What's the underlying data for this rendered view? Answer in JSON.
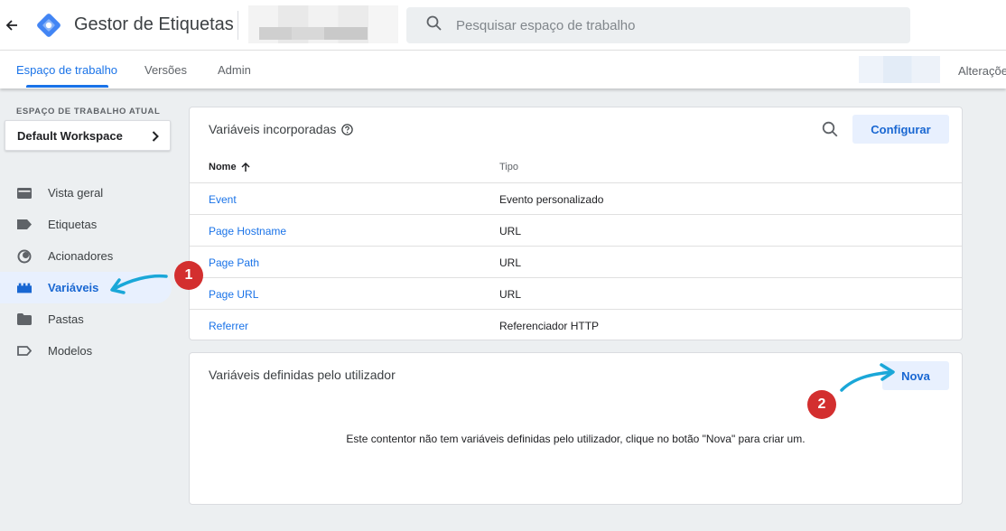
{
  "header": {
    "title": "Gestor de Etiquetas",
    "search_placeholder": "Pesquisar espaço de trabalho",
    "icons": [
      "back-arrow-icon",
      "tag-manager-logo-icon",
      "search-icon"
    ]
  },
  "tabs": [
    {
      "label": "Espaço de trabalho",
      "active": true
    },
    {
      "label": "Versões"
    },
    {
      "label": "Admin"
    }
  ],
  "toolbar_right": {
    "label": "Alterações"
  },
  "sidebar": {
    "workspace_label": "ESPAÇO DE TRABALHO ATUAL",
    "workspace_name": "Default Workspace",
    "items": [
      {
        "label": "Vista geral",
        "icon": "folder-overview-icon"
      },
      {
        "label": "Etiquetas",
        "icon": "tag-icon"
      },
      {
        "label": "Acionadores",
        "icon": "trigger-icon"
      },
      {
        "label": "Variáveis",
        "icon": "variables-icon",
        "active": true
      },
      {
        "label": "Pastas",
        "icon": "folder-icon"
      },
      {
        "label": "Modelos",
        "icon": "template-icon"
      }
    ]
  },
  "builtin": {
    "title": "Variáveis incorporadas",
    "configure_label": "Configurar",
    "col_name": "Nome",
    "col_type": "Tipo",
    "rows": [
      {
        "name": "Event",
        "type": "Evento personalizado"
      },
      {
        "name": "Page Hostname",
        "type": "URL"
      },
      {
        "name": "Page Path",
        "type": "URL"
      },
      {
        "name": "Page URL",
        "type": "URL"
      },
      {
        "name": "Referrer",
        "type": "Referenciador HTTP"
      }
    ]
  },
  "user_defined": {
    "title": "Variáveis definidas pelo utilizador",
    "new_label": "Nova",
    "empty_message": "Este contentor não tem variáveis definidas pelo utilizador, clique no botão \"Nova\" para criar um."
  },
  "annotations": {
    "badge1": "1",
    "badge2": "2"
  },
  "colors": {
    "accent": "#1a73e8",
    "active_bg": "#e8f0fe",
    "badge": "#d32f2f",
    "annotation_arrow": "#1aa7d8"
  }
}
